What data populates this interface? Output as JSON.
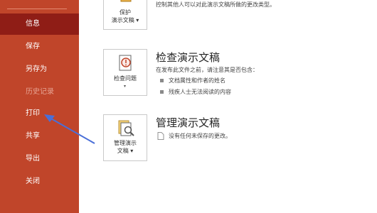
{
  "sidebar": {
    "items": [
      {
        "label": "信息",
        "state": "active"
      },
      {
        "label": "保存",
        "state": "normal"
      },
      {
        "label": "另存为",
        "state": "normal"
      },
      {
        "label": "历史记录",
        "state": "disabled"
      },
      {
        "label": "打印",
        "state": "normal"
      },
      {
        "label": "共享",
        "state": "normal"
      },
      {
        "label": "导出",
        "state": "normal"
      },
      {
        "label": "关闭",
        "state": "normal"
      }
    ]
  },
  "protect": {
    "button_line1": "保护",
    "button_line2": "演示文稿",
    "description": "控制其他人可以对此演示文稿所做的更改类型。"
  },
  "inspect": {
    "button_label": "检查问题",
    "title": "检查演示文稿",
    "intro": "在发布此文件之前，请注意其是否包含：",
    "bullets": [
      "文档属性和作者的姓名",
      "残疾人士无法阅读的内容"
    ]
  },
  "manage": {
    "button_line1": "管理演示",
    "button_line2": "文稿",
    "title": "管理演示文稿",
    "status": "没有任何未保存的更改。"
  },
  "colors": {
    "sidebar_bg": "#c0452a",
    "active_item": "#8f1d16",
    "arrow": "#4a6fd8"
  }
}
